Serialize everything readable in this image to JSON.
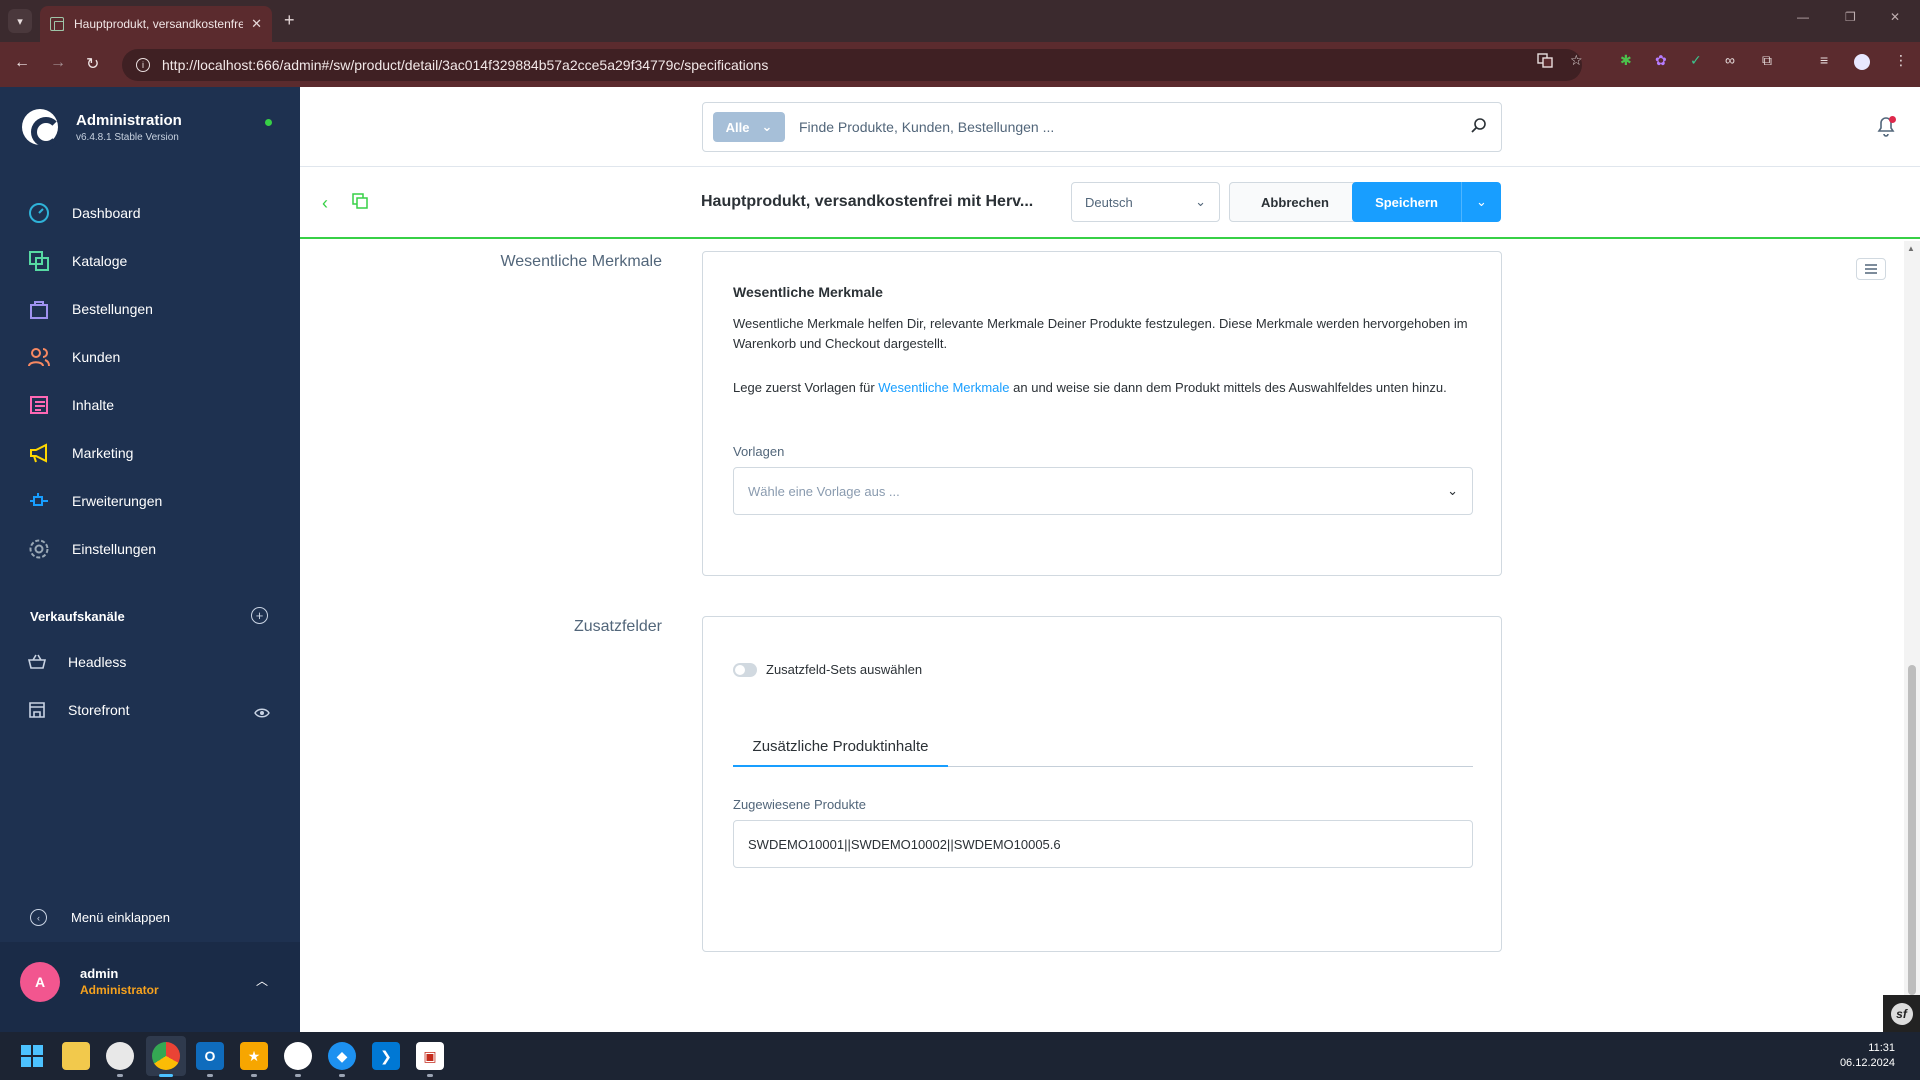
{
  "browser": {
    "tab_title": "Hauptprodukt, versandkostenfrei",
    "tab_close": "✕",
    "new_tab": "+",
    "url": "http://localhost:666/admin#/sw/product/detail/3ac014f329884b57a2cce5a29f34779c/specifications",
    "min": "—",
    "max": "❐",
    "close": "✕"
  },
  "sidebar": {
    "brand_title": "Administration",
    "brand_version": "v6.4.8.1 Stable Version",
    "nav": [
      {
        "label": "Dashboard",
        "icon": "dashboard-icon",
        "color": "#2fb3d9"
      },
      {
        "label": "Kataloge",
        "icon": "catalog-icon",
        "color": "#57d9a3"
      },
      {
        "label": "Bestellungen",
        "icon": "orders-icon",
        "color": "#a092f0"
      },
      {
        "label": "Kunden",
        "icon": "customers-icon",
        "color": "#f88962"
      },
      {
        "label": "Inhalte",
        "icon": "content-icon",
        "color": "#ff68b4"
      },
      {
        "label": "Marketing",
        "icon": "marketing-icon",
        "color": "#ffd700"
      },
      {
        "label": "Erweiterungen",
        "icon": "extensions-icon",
        "color": "#189eff"
      },
      {
        "label": "Einstellungen",
        "icon": "settings-icon",
        "color": "#9aa8b5"
      }
    ],
    "channels_heading": "Verkaufskanäle",
    "channels": [
      {
        "label": "Headless"
      },
      {
        "label": "Storefront"
      }
    ],
    "collapse_label": "Menü einklappen",
    "user_initial": "A",
    "user_name": "admin",
    "user_role": "Administrator"
  },
  "header": {
    "search_type": "Alle",
    "search_placeholder": "Finde Produkte, Kunden, Bestellungen ..."
  },
  "actionbar": {
    "product_title": "Hauptprodukt, versandkostenfrei mit Herv...",
    "language": "Deutsch",
    "cancel_label": "Abbrechen",
    "save_label": "Speichern"
  },
  "content": {
    "section1_label": "Wesentliche Merkmale",
    "card1_title": "Wesentliche Merkmale",
    "card1_desc": "Wesentliche Merkmale helfen Dir, relevante Merkmale Deiner Produkte festzulegen. Diese Merkmale werden hervorgehoben im Warenkorb und Checkout dargestellt.",
    "card1_hint_pre": "Lege zuerst Vorlagen für ",
    "card1_hint_link": "Wesentliche Merkmale",
    "card1_hint_post": " an und weise sie dann dem Produkt mittels des Auswahlfeldes unten hinzu.",
    "template_label": "Vorlagen",
    "template_placeholder": "Wähle eine Vorlage aus ...",
    "section2_label": "Zusatzfelder",
    "toggle_label": "Zusatzfeld-Sets auswählen",
    "tab_label": "Zusätzliche Produktinhalte",
    "assigned_label": "Zugewiesene Produkte",
    "assigned_value": "SWDEMO10001||SWDEMO10002||SWDEMO10005.6"
  },
  "taskbar": {
    "time": "11:31",
    "date": "06.12.2024"
  }
}
